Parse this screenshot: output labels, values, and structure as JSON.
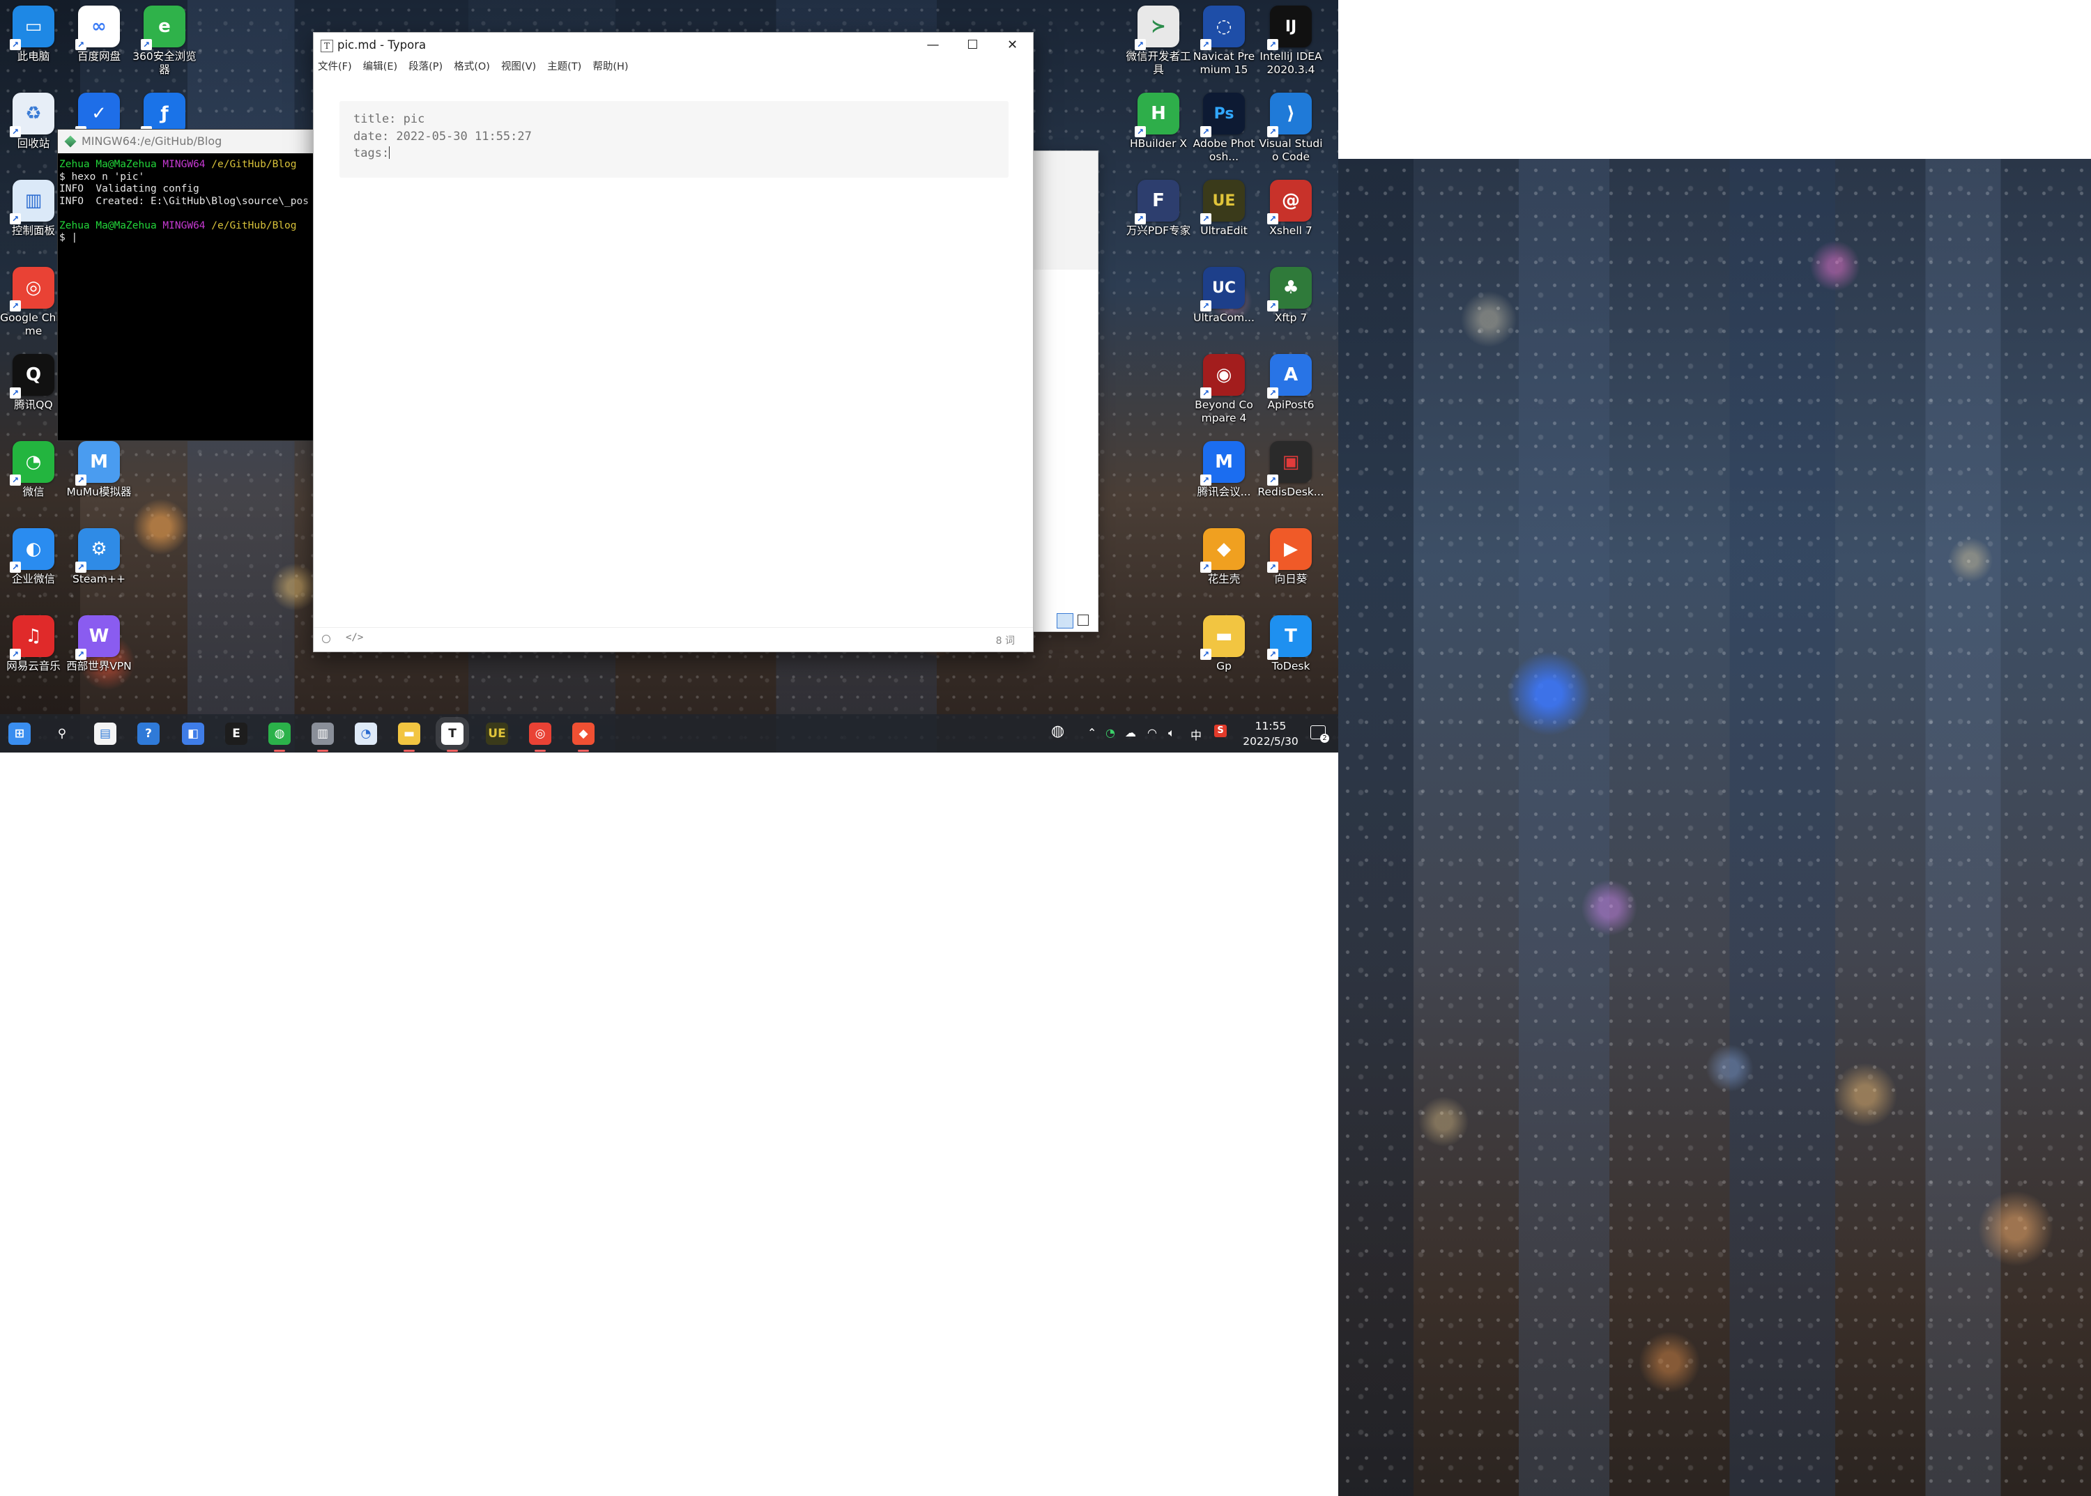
{
  "desktop": {
    "left_icons": [
      {
        "label": "此电脑",
        "glyph": "▭",
        "color": "#1e88e5"
      },
      {
        "label": "百度网盘",
        "glyph": "∞",
        "color": "#ffffff",
        "fg": "#3b7cf6"
      },
      {
        "label": "360安全浏览器",
        "glyph": "e",
        "color": "#2fb24a"
      },
      {
        "label": "回收站",
        "glyph": "♻",
        "color": "#e7eef7",
        "fg": "#3a7bd5"
      },
      {
        "label": "",
        "glyph": "✓",
        "color": "#1e6ee8"
      },
      {
        "label": "",
        "glyph": "ƒ",
        "color": "#1a73e8"
      },
      {
        "label": "控制面板",
        "glyph": "▥",
        "color": "#dbe9f8",
        "fg": "#2a6bd0"
      },
      {
        "label": "Google Chrome",
        "glyph": "◎",
        "color": "#e94235"
      },
      {
        "label": "腾讯QQ",
        "glyph": "Q",
        "color": "#111111"
      },
      {
        "label": "微信",
        "glyph": "◔",
        "color": "#23b53f"
      },
      {
        "label": "MuMu模拟器",
        "glyph": "M",
        "color": "#4a9cf0"
      },
      {
        "label": "企业微信",
        "glyph": "◐",
        "color": "#2a8cf0"
      },
      {
        "label": "Steam++",
        "glyph": "⚙",
        "color": "#2f8be6"
      },
      {
        "label": "网易云音乐",
        "glyph": "♫",
        "color": "#e02a2a"
      },
      {
        "label": "西部世界VPN",
        "glyph": "W",
        "color": "#8a5cf0"
      }
    ],
    "right_icons": [
      {
        "label": "微信开发者工具",
        "glyph": "≻",
        "color": "#e8e8e8",
        "fg": "#2a8c4a"
      },
      {
        "label": "Navicat Premium 15",
        "glyph": "◌",
        "color": "#1e4ea8"
      },
      {
        "label": "IntelliJ IDEA 2020.3.4",
        "glyph": "IJ",
        "color": "#111111"
      },
      {
        "label": "HBuilder X",
        "glyph": "H",
        "color": "#2eae4a"
      },
      {
        "label": "Adobe Photosh...",
        "glyph": "Ps",
        "color": "#0d1a33",
        "fg": "#31a8ff"
      },
      {
        "label": "Visual Studio Code",
        "glyph": "⟩",
        "color": "#1f7ad8"
      },
      {
        "label": "万兴PDF专家",
        "glyph": "F",
        "color": "#2d3e6e"
      },
      {
        "label": "UltraEdit",
        "glyph": "UE",
        "color": "#3a3a1a",
        "fg": "#e0c43a"
      },
      {
        "label": "Xshell 7",
        "glyph": "@",
        "color": "#c8322a"
      },
      {
        "label": "UltraCom...",
        "glyph": "UC",
        "color": "#1d3f8a"
      },
      {
        "label": "Xftp 7",
        "glyph": "♣",
        "color": "#2f7a3a"
      },
      {
        "label": "Beyond Compare 4",
        "glyph": "◉",
        "color": "#a31d1d"
      },
      {
        "label": "ApiPost6",
        "glyph": "A",
        "color": "#2874e6"
      },
      {
        "label": "腾讯会议...",
        "glyph": "M",
        "color": "#1b6df0"
      },
      {
        "label": "RedisDesk...",
        "glyph": "▣",
        "color": "#2a2a2a",
        "fg": "#e23b3b"
      },
      {
        "label": "花生壳",
        "glyph": "◆",
        "color": "#f0a020"
      },
      {
        "label": "向日葵",
        "glyph": "▶",
        "color": "#f05a28"
      },
      {
        "label": "Gp",
        "glyph": "▬",
        "color": "#f2c541"
      },
      {
        "label": "ToDesk",
        "glyph": "T",
        "color": "#1e90f0"
      }
    ]
  },
  "terminal": {
    "title": "MINGW64:/e/GitHub/Blog",
    "prompt_user": "Zehua Ma@MaZehua",
    "prompt_env": "MINGW64",
    "prompt_path": "/e/GitHub/Blog",
    "command": "$ hexo n 'pic'",
    "output_1": "INFO  Validating config",
    "output_2": "INFO  Created: E:\\GitHub\\Blog\\source\\_pos",
    "cursor_line": "$ |"
  },
  "typora": {
    "title": "pic.md - Typora",
    "menu": [
      "文件(F)",
      "编辑(E)",
      "段落(P)",
      "格式(O)",
      "视图(V)",
      "主题(T)",
      "帮助(H)"
    ],
    "front_matter": {
      "line1": "title: pic",
      "line2": "date: 2022-05-30 11:55:27",
      "line3": "tags:"
    },
    "word_count": "8 词"
  },
  "taskbar": {
    "apps": [
      {
        "name": "start",
        "glyph": "⊞",
        "color": "#3a8ef0"
      },
      {
        "name": "search",
        "glyph": "⚲",
        "color": "transparent"
      },
      {
        "name": "store",
        "glyph": "▤",
        "color": "#f4f4f4",
        "fg": "#2f7ad8"
      },
      {
        "name": "help",
        "glyph": "?",
        "color": "#2f7ad8"
      },
      {
        "name": "widgets",
        "glyph": "◧",
        "color": "#3f7de8"
      },
      {
        "name": "everything",
        "glyph": "E",
        "color": "#1d1d1d"
      },
      {
        "name": "music",
        "glyph": "◍",
        "color": "#2bb24a"
      },
      {
        "name": "printer",
        "glyph": "▥",
        "color": "#8a8f99"
      },
      {
        "name": "flashfxp",
        "glyph": "◔",
        "color": "#dfeaf7",
        "fg": "#2a6bd0"
      },
      {
        "name": "file-explorer",
        "glyph": "▬",
        "color": "#f2c541"
      },
      {
        "name": "typora",
        "glyph": "T",
        "color": "#ffffff",
        "fg": "#222222"
      },
      {
        "name": "ultraedit",
        "glyph": "UE",
        "color": "#3a3a1a",
        "fg": "#e0c43a"
      },
      {
        "name": "chrome",
        "glyph": "◎",
        "color": "#e94235"
      },
      {
        "name": "git",
        "glyph": "◆",
        "color": "#f05033"
      }
    ],
    "ime": "中",
    "time": "11:55",
    "date": "2022/5/30",
    "notification_count": "2"
  }
}
